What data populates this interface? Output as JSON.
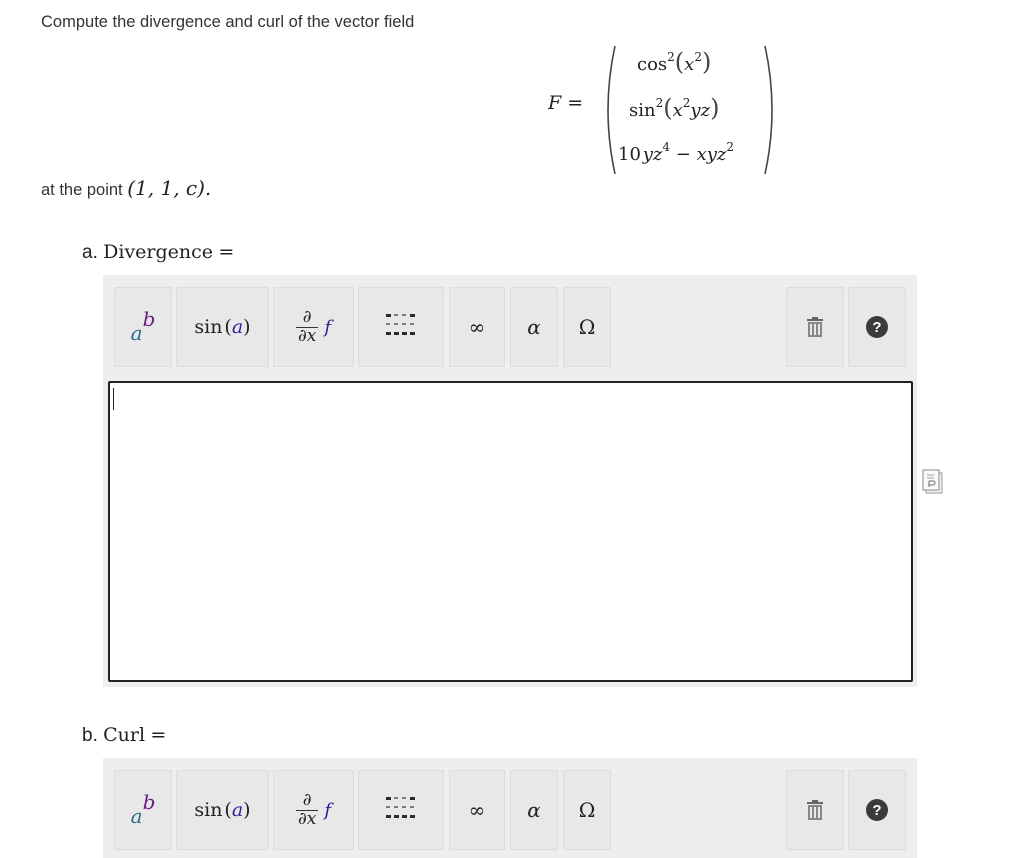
{
  "prompt": "Compute the divergence and curl of the vector field",
  "vector_field": {
    "lhs": "F =",
    "components": [
      {
        "fn": "cos",
        "pow": "2",
        "arg_base": "x",
        "arg_pow": "2",
        "arg_rest": ""
      },
      {
        "fn": "sin",
        "pow": "2",
        "arg_base": "x",
        "arg_pow": "2",
        "arg_rest": "yz"
      },
      {
        "lead": "10",
        "term1_base": "yz",
        "term1_pow": "4",
        "op": "−",
        "term2_base": "xyz",
        "term2_pow": "2"
      }
    ]
  },
  "point": {
    "prefix": "at the point",
    "coords": "(1, 1, c)."
  },
  "parts": [
    {
      "label": "a.",
      "name": "Divergence",
      "eq": "="
    },
    {
      "label": "b.",
      "name": "Curl",
      "eq": "="
    }
  ],
  "toolbar": {
    "power": {
      "base": "a",
      "exp": "b"
    },
    "sin": {
      "fn": "sin",
      "arg": "a"
    },
    "derivative": {
      "num": "∂",
      "den": "∂x",
      "fn": "f"
    },
    "infinity": "∞",
    "alpha": "α",
    "omega": "Ω",
    "help": "?"
  },
  "icons": [
    "matrix-icon",
    "trash-icon",
    "help-icon",
    "paste-icon"
  ],
  "answer": {
    "value": ""
  }
}
